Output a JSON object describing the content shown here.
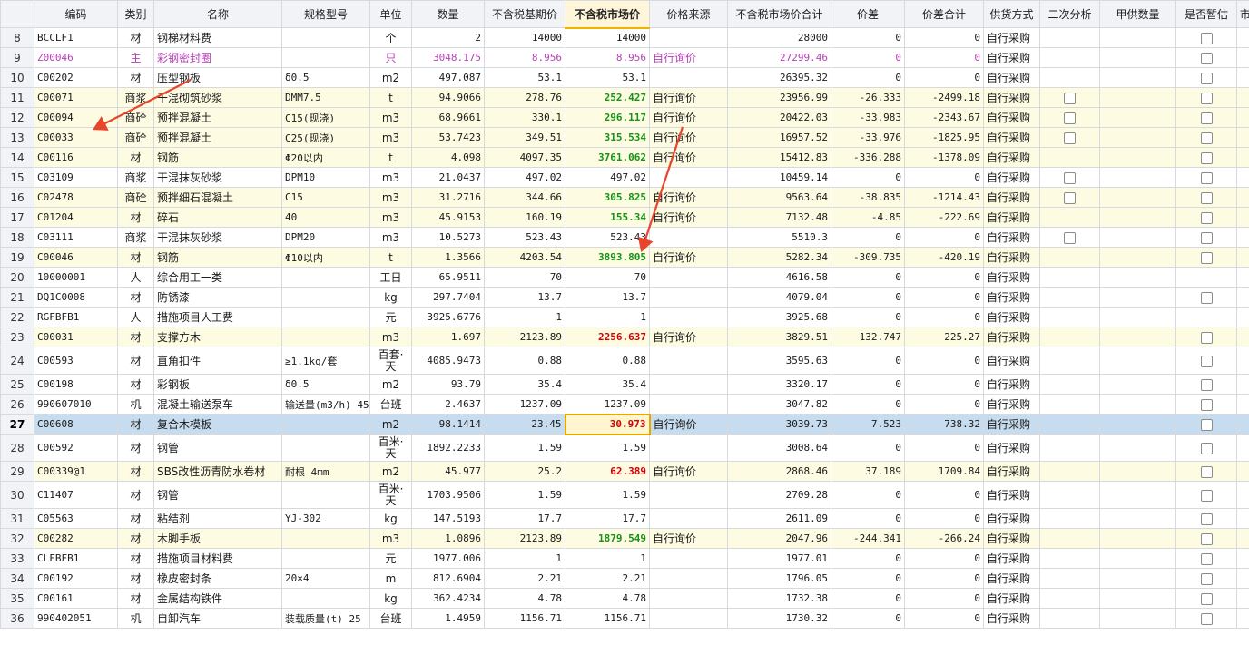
{
  "columns": [
    "",
    "编码",
    "类别",
    "名称",
    "规格型号",
    "单位",
    "数量",
    "不含税基期价",
    "不含税市场价",
    "价格来源",
    "不含税市场价合计",
    "价差",
    "价差合计",
    "供货方式",
    "二次分析",
    "甲供数量",
    "是否暂估",
    "市"
  ],
  "sort_column_index": 8,
  "colors": {
    "green": "#149414",
    "red": "#d40000",
    "magenta": "#b640b6",
    "highlight_row": "#fdfbe1",
    "selected_row": "#c7dcee",
    "arrow": "#e8452c"
  },
  "icons": {
    "checkbox": "checkbox-icon",
    "arrow": "annotation-arrow-icon"
  },
  "rows": [
    {
      "n": "8",
      "code": "BCCLF1",
      "type": "材",
      "name": "钢梯材料费",
      "spec": "",
      "unit": "个",
      "qty": "2",
      "base": "14000",
      "market": "14000",
      "src": "",
      "total": "28000",
      "diff": "0",
      "diffsum": "0",
      "supply": "自行采购",
      "sec": false,
      "est": true
    },
    {
      "n": "9",
      "code": "Z00046",
      "type": "主",
      "name": "彩钢密封圈",
      "spec": "",
      "unit": "只",
      "qty": "3048.175",
      "base": "8.956",
      "market": "8.956",
      "src": "自行询价",
      "total": "27299.46",
      "diff": "0",
      "diffsum": "0",
      "supply": "自行采购",
      "sec": false,
      "est": true,
      "magenta": true
    },
    {
      "n": "10",
      "code": "C00202",
      "type": "材",
      "name": "压型钢板",
      "spec": "δ0.5",
      "unit": "m2",
      "qty": "497.087",
      "base": "53.1",
      "market": "53.1",
      "src": "",
      "total": "26395.32",
      "diff": "0",
      "diffsum": "0",
      "supply": "自行采购",
      "sec": false,
      "est": true
    },
    {
      "n": "11",
      "code": "C00071",
      "type": "商浆",
      "name": "干混砌筑砂浆",
      "spec": "DMM7.5",
      "unit": "t",
      "qty": "94.9066",
      "base": "278.76",
      "market": "252.427",
      "src": "自行询价",
      "total": "23956.99",
      "diff": "-26.333",
      "diffsum": "-2499.18",
      "supply": "自行采购",
      "sec": true,
      "est": true,
      "hl": true,
      "mc": "green"
    },
    {
      "n": "12",
      "code": "C00094",
      "type": "商砼",
      "name": "预拌混凝土",
      "spec": "C15(现浇)",
      "unit": "m3",
      "qty": "68.9661",
      "base": "330.1",
      "market": "296.117",
      "src": "自行询价",
      "total": "20422.03",
      "diff": "-33.983",
      "diffsum": "-2343.67",
      "supply": "自行采购",
      "sec": true,
      "est": true,
      "hl": true,
      "mc": "green"
    },
    {
      "n": "13",
      "code": "C00033",
      "type": "商砼",
      "name": "预拌混凝土",
      "spec": "C25(现浇)",
      "unit": "m3",
      "qty": "53.7423",
      "base": "349.51",
      "market": "315.534",
      "src": "自行询价",
      "total": "16957.52",
      "diff": "-33.976",
      "diffsum": "-1825.95",
      "supply": "自行采购",
      "sec": true,
      "est": true,
      "hl": true,
      "mc": "green"
    },
    {
      "n": "14",
      "code": "C00116",
      "type": "材",
      "name": "钢筋",
      "spec": "Φ20以内",
      "unit": "t",
      "qty": "4.098",
      "base": "4097.35",
      "market": "3761.062",
      "src": "自行询价",
      "total": "15412.83",
      "diff": "-336.288",
      "diffsum": "-1378.09",
      "supply": "自行采购",
      "sec": false,
      "est": true,
      "hl": true,
      "mc": "green"
    },
    {
      "n": "15",
      "code": "C03109",
      "type": "商浆",
      "name": "干混抹灰砂浆",
      "spec": "DPM10",
      "unit": "m3",
      "qty": "21.0437",
      "base": "497.02",
      "market": "497.02",
      "src": "",
      "total": "10459.14",
      "diff": "0",
      "diffsum": "0",
      "supply": "自行采购",
      "sec": true,
      "est": true
    },
    {
      "n": "16",
      "code": "C02478",
      "type": "商砼",
      "name": "预拌细石混凝土",
      "spec": "C15",
      "unit": "m3",
      "qty": "31.2716",
      "base": "344.66",
      "market": "305.825",
      "src": "自行询价",
      "total": "9563.64",
      "diff": "-38.835",
      "diffsum": "-1214.43",
      "supply": "自行采购",
      "sec": true,
      "est": true,
      "hl": true,
      "mc": "green"
    },
    {
      "n": "17",
      "code": "C01204",
      "type": "材",
      "name": "碎石",
      "spec": "40",
      "unit": "m3",
      "qty": "45.9153",
      "base": "160.19",
      "market": "155.34",
      "src": "自行询价",
      "total": "7132.48",
      "diff": "-4.85",
      "diffsum": "-222.69",
      "supply": "自行采购",
      "sec": false,
      "est": true,
      "hl": true,
      "mc": "green"
    },
    {
      "n": "18",
      "code": "C03111",
      "type": "商浆",
      "name": "干混抹灰砂浆",
      "spec": "DPM20",
      "unit": "m3",
      "qty": "10.5273",
      "base": "523.43",
      "market": "523.43",
      "src": "",
      "total": "5510.3",
      "diff": "0",
      "diffsum": "0",
      "supply": "自行采购",
      "sec": true,
      "est": true
    },
    {
      "n": "19",
      "code": "C00046",
      "type": "材",
      "name": "钢筋",
      "spec": "Φ10以内",
      "unit": "t",
      "qty": "1.3566",
      "base": "4203.54",
      "market": "3893.805",
      "src": "自行询价",
      "total": "5282.34",
      "diff": "-309.735",
      "diffsum": "-420.19",
      "supply": "自行采购",
      "sec": false,
      "est": true,
      "hl": true,
      "mc": "green"
    },
    {
      "n": "20",
      "code": "10000001",
      "type": "人",
      "name": "综合用工一类",
      "spec": "",
      "unit": "工日",
      "qty": "65.9511",
      "base": "70",
      "market": "70",
      "src": "",
      "total": "4616.58",
      "diff": "0",
      "diffsum": "0",
      "supply": "自行采购",
      "sec": false,
      "est": false
    },
    {
      "n": "21",
      "code": "DQ1C0008",
      "type": "材",
      "name": "防锈漆",
      "spec": "",
      "unit": "kg",
      "qty": "297.7404",
      "base": "13.7",
      "market": "13.7",
      "src": "",
      "total": "4079.04",
      "diff": "0",
      "diffsum": "0",
      "supply": "自行采购",
      "sec": false,
      "est": true
    },
    {
      "n": "22",
      "code": "RGFBFB1",
      "type": "人",
      "name": "措施项目人工费",
      "spec": "",
      "unit": "元",
      "qty": "3925.6776",
      "base": "1",
      "market": "1",
      "src": "",
      "total": "3925.68",
      "diff": "0",
      "diffsum": "0",
      "supply": "自行采购",
      "sec": false,
      "est": false
    },
    {
      "n": "23",
      "code": "C00031",
      "type": "材",
      "name": "支撑方木",
      "spec": "",
      "unit": "m3",
      "qty": "1.697",
      "base": "2123.89",
      "market": "2256.637",
      "src": "自行询价",
      "total": "3829.51",
      "diff": "132.747",
      "diffsum": "225.27",
      "supply": "自行采购",
      "sec": false,
      "est": true,
      "hl": true,
      "mc": "red"
    },
    {
      "n": "24",
      "code": "C00593",
      "type": "材",
      "name": "直角扣件",
      "spec": "≥1.1kg/套",
      "unit": "百套·天",
      "qty": "4085.9473",
      "base": "0.88",
      "market": "0.88",
      "src": "",
      "total": "3595.63",
      "diff": "0",
      "diffsum": "0",
      "supply": "自行采购",
      "sec": false,
      "est": true,
      "tall": true
    },
    {
      "n": "25",
      "code": "C00198",
      "type": "材",
      "name": "彩钢板",
      "spec": "δ0.5",
      "unit": "m2",
      "qty": "93.79",
      "base": "35.4",
      "market": "35.4",
      "src": "",
      "total": "3320.17",
      "diff": "0",
      "diffsum": "0",
      "supply": "自行采购",
      "sec": false,
      "est": true
    },
    {
      "n": "26",
      "code": "990607010",
      "type": "机",
      "name": "混凝土输送泵车",
      "spec": "输送量(m3/h) 45",
      "unit": "台班",
      "qty": "2.4637",
      "base": "1237.09",
      "market": "1237.09",
      "src": "",
      "total": "3047.82",
      "diff": "0",
      "diffsum": "0",
      "supply": "自行采购",
      "sec": false,
      "est": true
    },
    {
      "n": "27",
      "code": "C00608",
      "type": "材",
      "name": "复合木模板",
      "spec": "",
      "unit": "m2",
      "qty": "98.1414",
      "base": "23.45",
      "market": "30.973",
      "src": "自行询价",
      "total": "3039.73",
      "diff": "7.523",
      "diffsum": "738.32",
      "supply": "自行采购",
      "sec": false,
      "est": true,
      "sel": true,
      "mc": "red"
    },
    {
      "n": "28",
      "code": "C00592",
      "type": "材",
      "name": "钢管",
      "spec": "",
      "unit": "百米·天",
      "qty": "1892.2233",
      "base": "1.59",
      "market": "1.59",
      "src": "",
      "total": "3008.64",
      "diff": "0",
      "diffsum": "0",
      "supply": "自行采购",
      "sec": false,
      "est": true,
      "tall": true
    },
    {
      "n": "29",
      "code": "C00339@1",
      "type": "材",
      "name": "SBS改性沥青防水卷材",
      "spec": "耐根 4mm",
      "unit": "m2",
      "qty": "45.977",
      "base": "25.2",
      "market": "62.389",
      "src": "自行询价",
      "total": "2868.46",
      "diff": "37.189",
      "diffsum": "1709.84",
      "supply": "自行采购",
      "sec": false,
      "est": true,
      "hl": true,
      "mc": "red"
    },
    {
      "n": "30",
      "code": "C11407",
      "type": "材",
      "name": "钢管",
      "spec": "",
      "unit": "百米·天",
      "qty": "1703.9506",
      "base": "1.59",
      "market": "1.59",
      "src": "",
      "total": "2709.28",
      "diff": "0",
      "diffsum": "0",
      "supply": "自行采购",
      "sec": false,
      "est": true,
      "tall": true
    },
    {
      "n": "31",
      "code": "C05563",
      "type": "材",
      "name": "粘结剂",
      "spec": "YJ-302",
      "unit": "kg",
      "qty": "147.5193",
      "base": "17.7",
      "market": "17.7",
      "src": "",
      "total": "2611.09",
      "diff": "0",
      "diffsum": "0",
      "supply": "自行采购",
      "sec": false,
      "est": true
    },
    {
      "n": "32",
      "code": "C00282",
      "type": "材",
      "name": "木脚手板",
      "spec": "",
      "unit": "m3",
      "qty": "1.0896",
      "base": "2123.89",
      "market": "1879.549",
      "src": "自行询价",
      "total": "2047.96",
      "diff": "-244.341",
      "diffsum": "-266.24",
      "supply": "自行采购",
      "sec": false,
      "est": true,
      "hl": true,
      "mc": "green"
    },
    {
      "n": "33",
      "code": "CLFBFB1",
      "type": "材",
      "name": "措施项目材料费",
      "spec": "",
      "unit": "元",
      "qty": "1977.006",
      "base": "1",
      "market": "1",
      "src": "",
      "total": "1977.01",
      "diff": "0",
      "diffsum": "0",
      "supply": "自行采购",
      "sec": false,
      "est": true
    },
    {
      "n": "34",
      "code": "C00192",
      "type": "材",
      "name": "橡皮密封条",
      "spec": "20×4",
      "unit": "m",
      "qty": "812.6904",
      "base": "2.21",
      "market": "2.21",
      "src": "",
      "total": "1796.05",
      "diff": "0",
      "diffsum": "0",
      "supply": "自行采购",
      "sec": false,
      "est": true
    },
    {
      "n": "35",
      "code": "C00161",
      "type": "材",
      "name": "金属结构铁件",
      "spec": "",
      "unit": "kg",
      "qty": "362.4234",
      "base": "4.78",
      "market": "4.78",
      "src": "",
      "total": "1732.38",
      "diff": "0",
      "diffsum": "0",
      "supply": "自行采购",
      "sec": false,
      "est": true
    },
    {
      "n": "36",
      "code": "990402051",
      "type": "机",
      "name": "自卸汽车",
      "spec": "装载质量(t) 25",
      "unit": "台班",
      "qty": "1.4959",
      "base": "1156.71",
      "market": "1156.71",
      "src": "",
      "total": "1730.32",
      "diff": "0",
      "diffsum": "0",
      "supply": "自行采购",
      "sec": false,
      "est": true
    }
  ]
}
